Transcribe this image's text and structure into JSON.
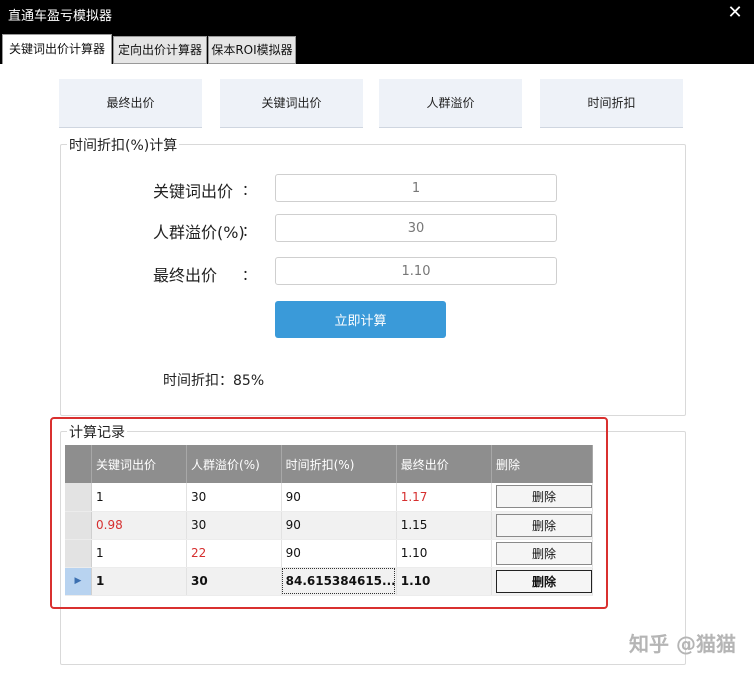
{
  "window": {
    "title": "直通车盈亏模拟器",
    "close_glyph": "✕"
  },
  "tabs": [
    {
      "label": "关键词出价计算器",
      "active": true
    },
    {
      "label": "定向出价计算器"
    },
    {
      "label": "保本ROI模拟器"
    }
  ],
  "nav": [
    "最终出价",
    "关键词出价",
    "人群溢价",
    "时间折扣"
  ],
  "calc_group": {
    "legend": "时间折扣(%)计算",
    "fields": [
      {
        "label": "关键词出价",
        "colon": "：",
        "value": "1"
      },
      {
        "label": "人群溢价(%)",
        "colon": "：",
        "value": "30"
      },
      {
        "label": "最终出价",
        "colon": "：",
        "value": "1.10"
      }
    ],
    "button": "立即计算",
    "result": "时间折扣：85%"
  },
  "records": {
    "legend": "计算记录",
    "columns": [
      "关键词出价",
      "人群溢价(%)",
      "时间折扣(%)",
      "最终出价",
      "删除"
    ],
    "rows": [
      {
        "cells": [
          "1",
          "30",
          "90",
          "1.17"
        ],
        "red": [
          3
        ],
        "delete": "删除"
      },
      {
        "cells": [
          "0.98",
          "30",
          "90",
          "1.15"
        ],
        "red": [
          0
        ],
        "delete": "删除"
      },
      {
        "cells": [
          "1",
          "22",
          "90",
          "1.10"
        ],
        "red": [
          1
        ],
        "delete": "删除"
      },
      {
        "cells": [
          "1",
          "30",
          "84.615384615...",
          "1.10"
        ],
        "red": [],
        "delete": "删除",
        "selected": true,
        "marker": "▶"
      }
    ]
  },
  "watermark": "知乎 @猫猫",
  "colors": {
    "accent": "#3a9ad9",
    "highlight": "#d9302f",
    "header": "#8e8e8e",
    "red_text": "#d62f2f"
  }
}
